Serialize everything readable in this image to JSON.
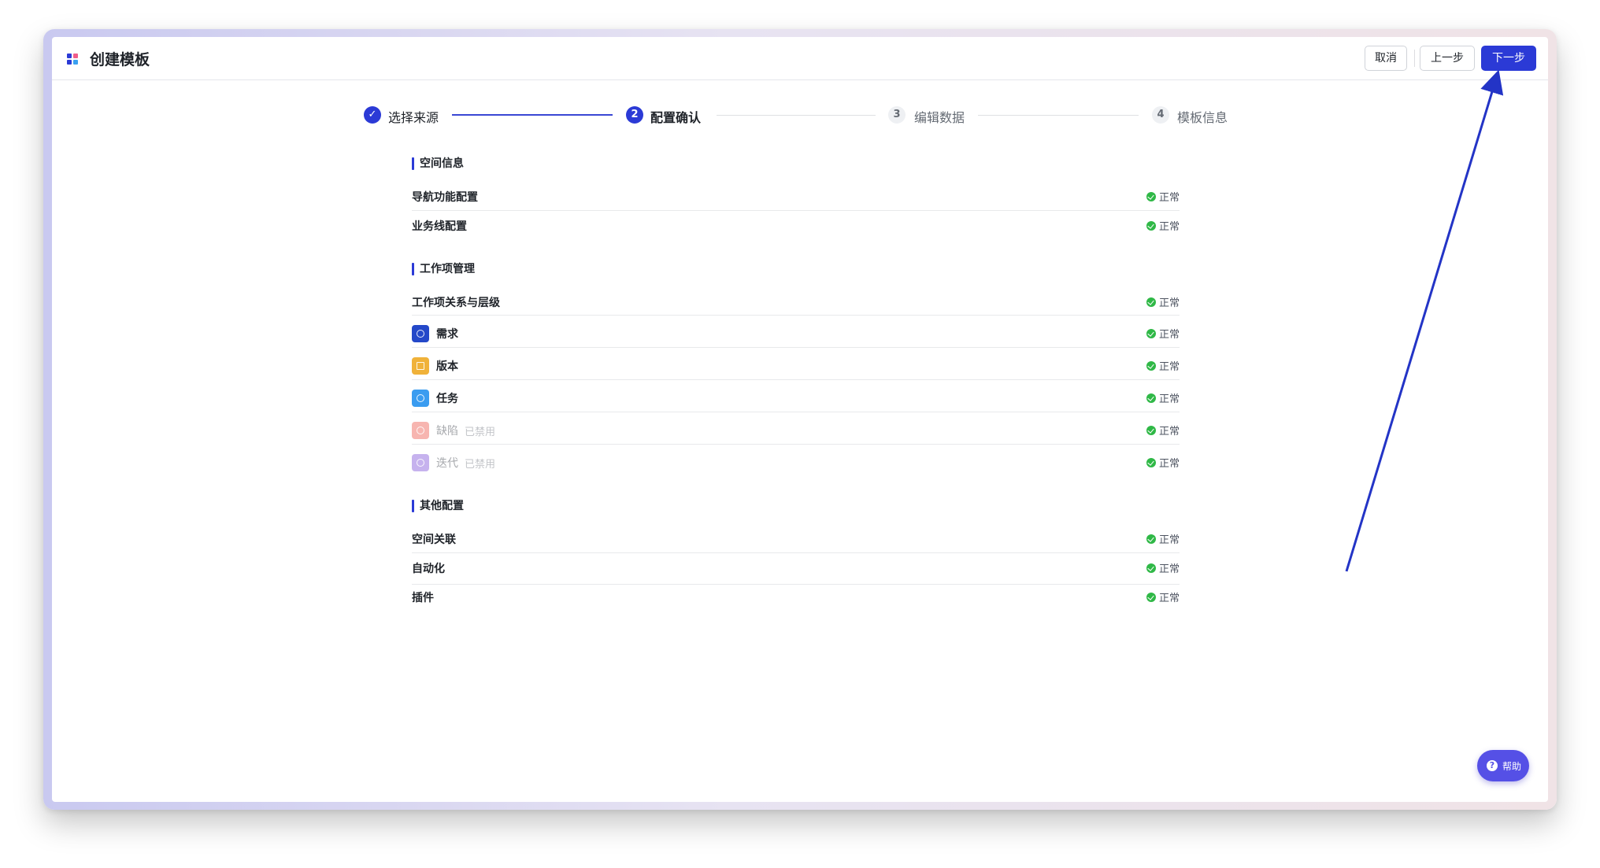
{
  "header": {
    "title": "创建模板",
    "cancel_label": "取消",
    "prev_label": "上一步",
    "next_label": "下一步"
  },
  "steps": [
    {
      "number": "✓",
      "label": "选择来源",
      "state": "done"
    },
    {
      "number": "2",
      "label": "配置确认",
      "state": "active"
    },
    {
      "number": "3",
      "label": "编辑数据",
      "state": "todo"
    },
    {
      "number": "4",
      "label": "模板信息",
      "state": "todo"
    }
  ],
  "sections": {
    "space": {
      "title": "空间信息",
      "rows": [
        {
          "label": "导航功能配置",
          "status": "正常"
        },
        {
          "label": "业务线配置",
          "status": "正常"
        }
      ]
    },
    "work": {
      "title": "工作项管理",
      "rows": [
        {
          "label": "工作项关系与层级",
          "status": "正常"
        },
        {
          "label": "需求",
          "status": "正常",
          "icon_color": "#2448c9"
        },
        {
          "label": "版本",
          "status": "正常",
          "icon_color": "#f0b23a"
        },
        {
          "label": "任务",
          "status": "正常",
          "icon_color": "#3a9cf0"
        },
        {
          "label": "缺陷",
          "tag": "已禁用",
          "status": "正常",
          "icon_color": "#f7b5b0"
        },
        {
          "label": "迭代",
          "tag": "已禁用",
          "status": "正常",
          "icon_color": "#c6b2ee"
        }
      ]
    },
    "other": {
      "title": "其他配置",
      "rows": [
        {
          "label": "空间关联",
          "status": "正常"
        },
        {
          "label": "自动化",
          "status": "正常"
        },
        {
          "label": "插件",
          "status": "正常"
        }
      ]
    }
  },
  "help": {
    "icon": "?",
    "label": "帮助"
  },
  "colors": {
    "accent": "#2b3ad6",
    "success": "#2fb846",
    "arrow": "#2334c6"
  }
}
